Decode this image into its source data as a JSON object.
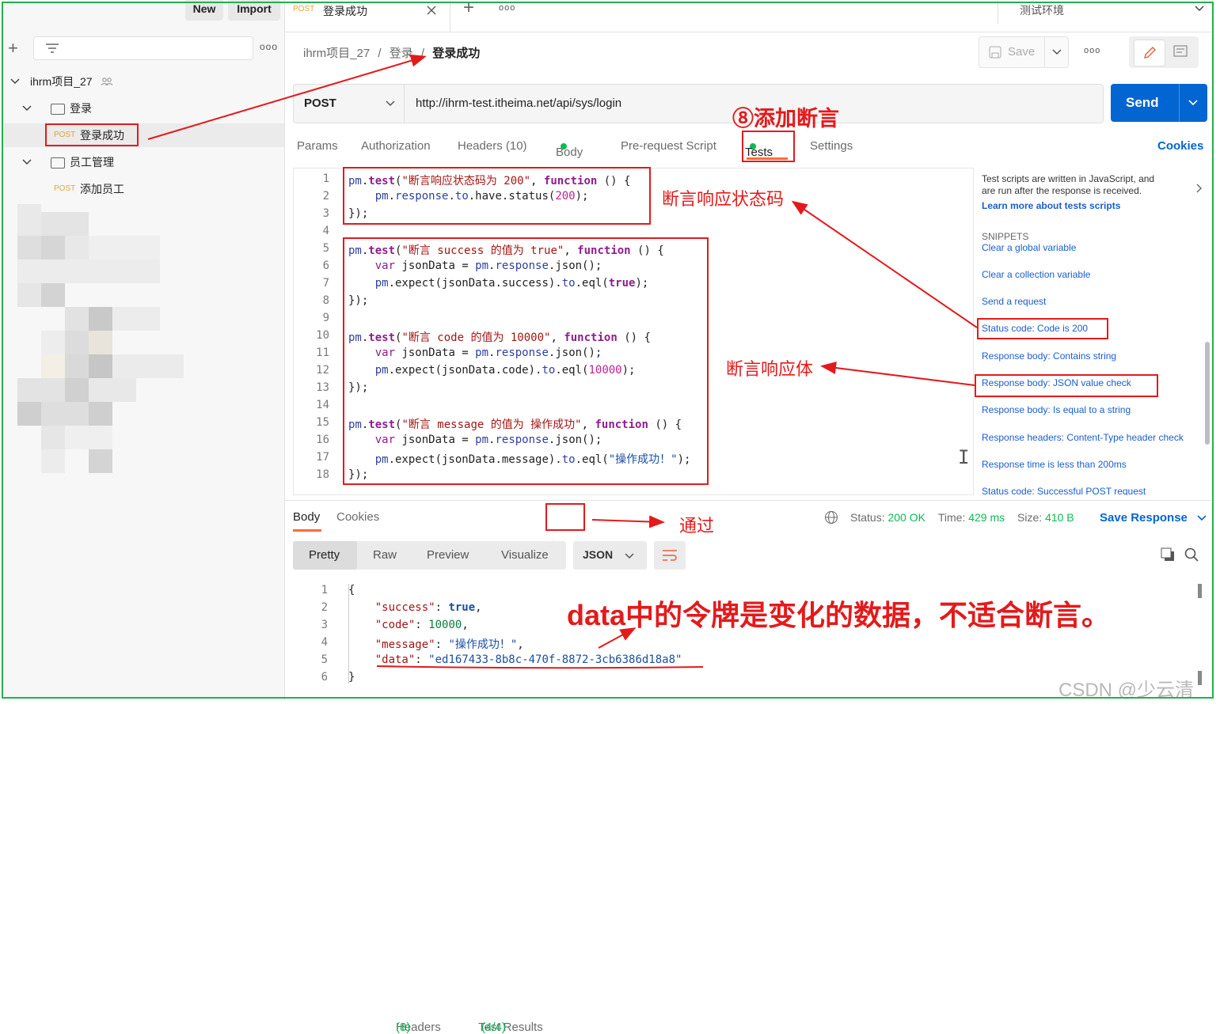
{
  "sidebar": {
    "new_label": "New",
    "import_label": "Import",
    "collection_name": "ihrm项目_27",
    "folders": [
      {
        "name": "登录",
        "requests": [
          {
            "method": "POST",
            "name": "登录成功"
          }
        ]
      },
      {
        "name": "员工管理",
        "requests": [
          {
            "method": "POST",
            "name": "添加员工"
          }
        ]
      }
    ]
  },
  "tab": {
    "method": "POST",
    "title": "登录成功",
    "environment": "测试环境"
  },
  "breadcrumb": {
    "collection": "ihrm项目_27",
    "sep": "/",
    "folder": "登录",
    "request": "登录成功"
  },
  "toolbar": {
    "save_label": "Save"
  },
  "request": {
    "method": "POST",
    "url": "http://ihrm-test.itheima.net/api/sys/login",
    "send_label": "Send",
    "tabs": {
      "params": "Params",
      "authorization": "Authorization",
      "headers": "Headers (10)",
      "body": "Body",
      "prerequest": "Pre-request Script",
      "tests": "Tests",
      "settings": "Settings",
      "cookies": "Cookies"
    }
  },
  "editor": {
    "line_numbers": [
      "1",
      "2",
      "3",
      "4",
      "5",
      "6",
      "7",
      "8",
      "9",
      "10",
      "11",
      "12",
      "13",
      "14",
      "15",
      "16",
      "17",
      "18"
    ]
  },
  "snippets_panel": {
    "info_line1": "Test scripts are written in JavaScript, and",
    "info_line2": "are run after the response is received.",
    "learn_more": "Learn more about tests scripts",
    "snippets_heading": "SNIPPETS",
    "items": [
      "Clear a global variable",
      "Clear a collection variable",
      "Send a request",
      "Status code: Code is 200",
      "Response body: Contains string",
      "Response body: JSON value check",
      "Response body: Is equal to a string",
      "Response headers: Content-Type header check",
      "Response time is less than 200ms",
      "Status code: Successful POST request"
    ]
  },
  "response": {
    "tabs": {
      "body": "Body",
      "cookies": "Cookies",
      "headers": "Headers",
      "headers_count": "(8)",
      "test_results": "Test Results",
      "test_count": "(4/4)"
    },
    "status_label": "Status:",
    "status_value": "200 OK",
    "time_label": "Time:",
    "time_value": "429 ms",
    "size_label": "Size:",
    "size_value": "410 B",
    "save_response": "Save Response",
    "view_modes": {
      "pretty": "Pretty",
      "raw": "Raw",
      "preview": "Preview",
      "visualize": "Visualize"
    },
    "format": "JSON",
    "line_numbers": [
      "1",
      "2",
      "3",
      "4",
      "5",
      "6"
    ]
  },
  "annotations": {
    "add_assertion": "⑧添加断言",
    "assert_status": "断言响应状态码",
    "assert_body": "断言响应体",
    "passed": "通过",
    "token_note": "data中的令牌是变化的数据，不适合断言。"
  },
  "watermark": "CSDN @少云清",
  "colors": {
    "accent_blue": "#0265d2",
    "annotation_red": "#e31a1c",
    "green_ok": "#0cbb52",
    "frame_green": "#22b14c"
  }
}
